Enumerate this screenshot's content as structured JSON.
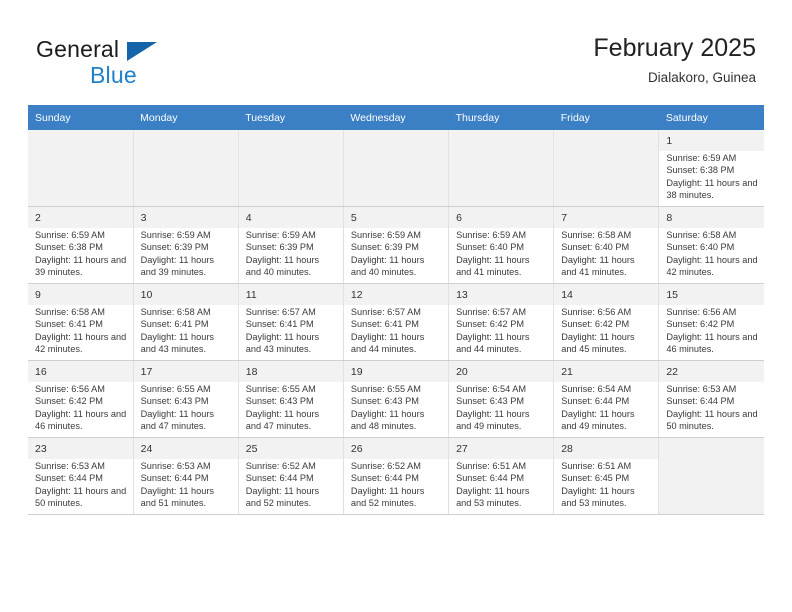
{
  "brand": {
    "name_primary": "General",
    "name_secondary": "Blue",
    "triangle_color": "#1464aa",
    "blue_text_color": "#2081c8"
  },
  "header": {
    "title": "February 2025",
    "subtitle": "Dialakoro, Guinea"
  },
  "theme": {
    "header_row_bg": "#3b7fc4",
    "header_row_text": "#ffffff",
    "daynum_bg": "#f2f2f2",
    "empty_cell_bg": "#f2f2f2",
    "grid_line": "#cfcfcf"
  },
  "weekdays": [
    {
      "label": "Sunday"
    },
    {
      "label": "Monday"
    },
    {
      "label": "Tuesday"
    },
    {
      "label": "Wednesday"
    },
    {
      "label": "Thursday"
    },
    {
      "label": "Friday"
    },
    {
      "label": "Saturday"
    }
  ],
  "weeks": [
    [
      {
        "day": "",
        "sunrise": "",
        "sunset": "",
        "daylight": "",
        "empty": true
      },
      {
        "day": "",
        "sunrise": "",
        "sunset": "",
        "daylight": "",
        "empty": true
      },
      {
        "day": "",
        "sunrise": "",
        "sunset": "",
        "daylight": "",
        "empty": true
      },
      {
        "day": "",
        "sunrise": "",
        "sunset": "",
        "daylight": "",
        "empty": true
      },
      {
        "day": "",
        "sunrise": "",
        "sunset": "",
        "daylight": "",
        "empty": true
      },
      {
        "day": "",
        "sunrise": "",
        "sunset": "",
        "daylight": "",
        "empty": true
      },
      {
        "day": "1",
        "sunrise": "Sunrise: 6:59 AM",
        "sunset": "Sunset: 6:38 PM",
        "daylight": "Daylight: 11 hours and 38 minutes.",
        "empty": false
      }
    ],
    [
      {
        "day": "2",
        "sunrise": "Sunrise: 6:59 AM",
        "sunset": "Sunset: 6:38 PM",
        "daylight": "Daylight: 11 hours and 39 minutes.",
        "empty": false
      },
      {
        "day": "3",
        "sunrise": "Sunrise: 6:59 AM",
        "sunset": "Sunset: 6:39 PM",
        "daylight": "Daylight: 11 hours and 39 minutes.",
        "empty": false
      },
      {
        "day": "4",
        "sunrise": "Sunrise: 6:59 AM",
        "sunset": "Sunset: 6:39 PM",
        "daylight": "Daylight: 11 hours and 40 minutes.",
        "empty": false
      },
      {
        "day": "5",
        "sunrise": "Sunrise: 6:59 AM",
        "sunset": "Sunset: 6:39 PM",
        "daylight": "Daylight: 11 hours and 40 minutes.",
        "empty": false
      },
      {
        "day": "6",
        "sunrise": "Sunrise: 6:59 AM",
        "sunset": "Sunset: 6:40 PM",
        "daylight": "Daylight: 11 hours and 41 minutes.",
        "empty": false
      },
      {
        "day": "7",
        "sunrise": "Sunrise: 6:58 AM",
        "sunset": "Sunset: 6:40 PM",
        "daylight": "Daylight: 11 hours and 41 minutes.",
        "empty": false
      },
      {
        "day": "8",
        "sunrise": "Sunrise: 6:58 AM",
        "sunset": "Sunset: 6:40 PM",
        "daylight": "Daylight: 11 hours and 42 minutes.",
        "empty": false
      }
    ],
    [
      {
        "day": "9",
        "sunrise": "Sunrise: 6:58 AM",
        "sunset": "Sunset: 6:41 PM",
        "daylight": "Daylight: 11 hours and 42 minutes.",
        "empty": false
      },
      {
        "day": "10",
        "sunrise": "Sunrise: 6:58 AM",
        "sunset": "Sunset: 6:41 PM",
        "daylight": "Daylight: 11 hours and 43 minutes.",
        "empty": false
      },
      {
        "day": "11",
        "sunrise": "Sunrise: 6:57 AM",
        "sunset": "Sunset: 6:41 PM",
        "daylight": "Daylight: 11 hours and 43 minutes.",
        "empty": false
      },
      {
        "day": "12",
        "sunrise": "Sunrise: 6:57 AM",
        "sunset": "Sunset: 6:41 PM",
        "daylight": "Daylight: 11 hours and 44 minutes.",
        "empty": false
      },
      {
        "day": "13",
        "sunrise": "Sunrise: 6:57 AM",
        "sunset": "Sunset: 6:42 PM",
        "daylight": "Daylight: 11 hours and 44 minutes.",
        "empty": false
      },
      {
        "day": "14",
        "sunrise": "Sunrise: 6:56 AM",
        "sunset": "Sunset: 6:42 PM",
        "daylight": "Daylight: 11 hours and 45 minutes.",
        "empty": false
      },
      {
        "day": "15",
        "sunrise": "Sunrise: 6:56 AM",
        "sunset": "Sunset: 6:42 PM",
        "daylight": "Daylight: 11 hours and 46 minutes.",
        "empty": false
      }
    ],
    [
      {
        "day": "16",
        "sunrise": "Sunrise: 6:56 AM",
        "sunset": "Sunset: 6:42 PM",
        "daylight": "Daylight: 11 hours and 46 minutes.",
        "empty": false
      },
      {
        "day": "17",
        "sunrise": "Sunrise: 6:55 AM",
        "sunset": "Sunset: 6:43 PM",
        "daylight": "Daylight: 11 hours and 47 minutes.",
        "empty": false
      },
      {
        "day": "18",
        "sunrise": "Sunrise: 6:55 AM",
        "sunset": "Sunset: 6:43 PM",
        "daylight": "Daylight: 11 hours and 47 minutes.",
        "empty": false
      },
      {
        "day": "19",
        "sunrise": "Sunrise: 6:55 AM",
        "sunset": "Sunset: 6:43 PM",
        "daylight": "Daylight: 11 hours and 48 minutes.",
        "empty": false
      },
      {
        "day": "20",
        "sunrise": "Sunrise: 6:54 AM",
        "sunset": "Sunset: 6:43 PM",
        "daylight": "Daylight: 11 hours and 49 minutes.",
        "empty": false
      },
      {
        "day": "21",
        "sunrise": "Sunrise: 6:54 AM",
        "sunset": "Sunset: 6:44 PM",
        "daylight": "Daylight: 11 hours and 49 minutes.",
        "empty": false
      },
      {
        "day": "22",
        "sunrise": "Sunrise: 6:53 AM",
        "sunset": "Sunset: 6:44 PM",
        "daylight": "Daylight: 11 hours and 50 minutes.",
        "empty": false
      }
    ],
    [
      {
        "day": "23",
        "sunrise": "Sunrise: 6:53 AM",
        "sunset": "Sunset: 6:44 PM",
        "daylight": "Daylight: 11 hours and 50 minutes.",
        "empty": false
      },
      {
        "day": "24",
        "sunrise": "Sunrise: 6:53 AM",
        "sunset": "Sunset: 6:44 PM",
        "daylight": "Daylight: 11 hours and 51 minutes.",
        "empty": false
      },
      {
        "day": "25",
        "sunrise": "Sunrise: 6:52 AM",
        "sunset": "Sunset: 6:44 PM",
        "daylight": "Daylight: 11 hours and 52 minutes.",
        "empty": false
      },
      {
        "day": "26",
        "sunrise": "Sunrise: 6:52 AM",
        "sunset": "Sunset: 6:44 PM",
        "daylight": "Daylight: 11 hours and 52 minutes.",
        "empty": false
      },
      {
        "day": "27",
        "sunrise": "Sunrise: 6:51 AM",
        "sunset": "Sunset: 6:44 PM",
        "daylight": "Daylight: 11 hours and 53 minutes.",
        "empty": false
      },
      {
        "day": "28",
        "sunrise": "Sunrise: 6:51 AM",
        "sunset": "Sunset: 6:45 PM",
        "daylight": "Daylight: 11 hours and 53 minutes.",
        "empty": false
      },
      {
        "day": "",
        "sunrise": "",
        "sunset": "",
        "daylight": "",
        "empty": true
      }
    ]
  ]
}
